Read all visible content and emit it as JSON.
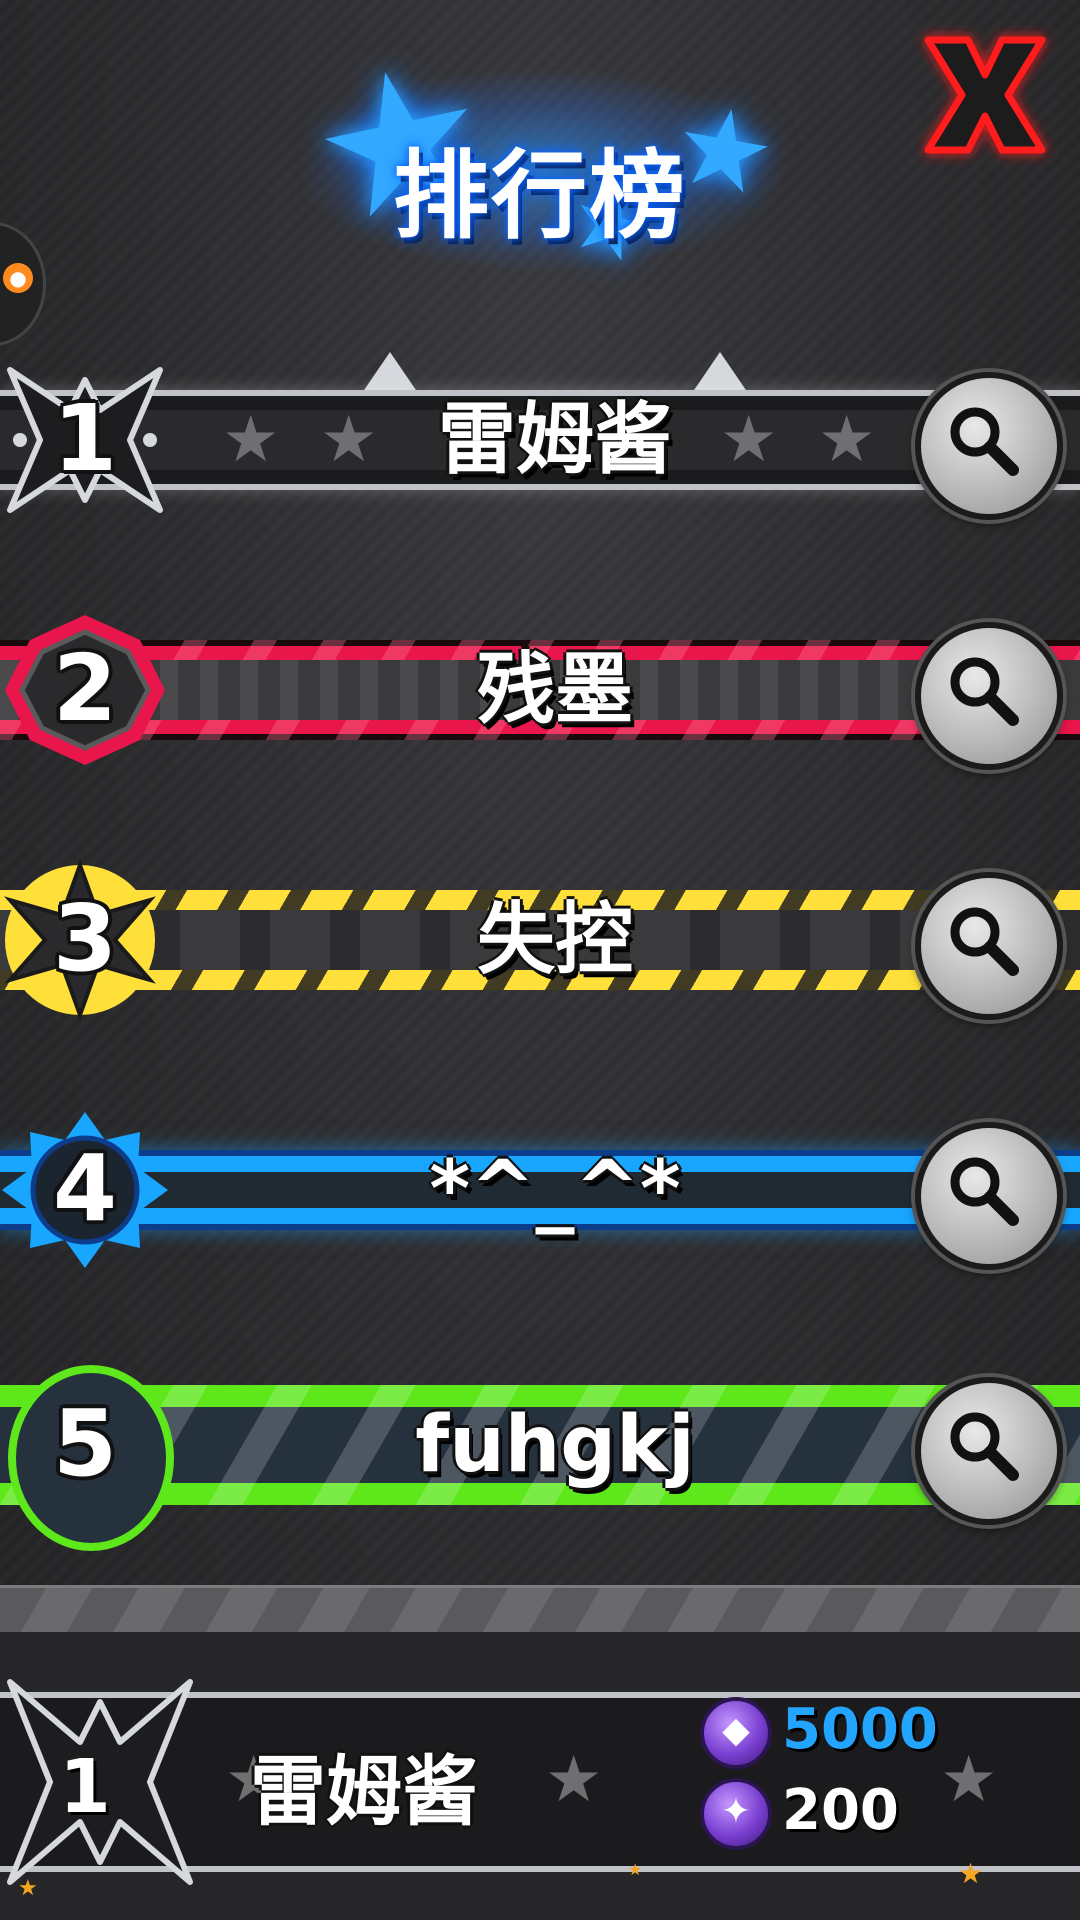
{
  "header": {
    "title": "排行榜",
    "close_icon": "close-icon"
  },
  "leaderboard": {
    "rows": [
      {
        "rank": "1",
        "name": "雷姆酱",
        "theme": "silver",
        "accent": "#c8cbd0"
      },
      {
        "rank": "2",
        "name": "残墨",
        "theme": "red",
        "accent": "#e8164a"
      },
      {
        "rank": "3",
        "name": "失控",
        "theme": "yellow",
        "accent": "#ffe03a"
      },
      {
        "rank": "4",
        "name": "*^_^*",
        "theme": "blue",
        "accent": "#18a6ff"
      },
      {
        "rank": "5",
        "name": "fuhgkj",
        "theme": "green",
        "accent": "#5ee81c"
      }
    ],
    "search_icon": "search-icon"
  },
  "my_rank": {
    "rank": "1",
    "name": "雷姆酱",
    "currencies": [
      {
        "icon": "purple-gem-coin-icon",
        "amount": "5000",
        "color": "#22a4ff"
      },
      {
        "icon": "purple-crystal-coin-icon",
        "amount": "200",
        "color": "#ffffff"
      }
    ]
  }
}
